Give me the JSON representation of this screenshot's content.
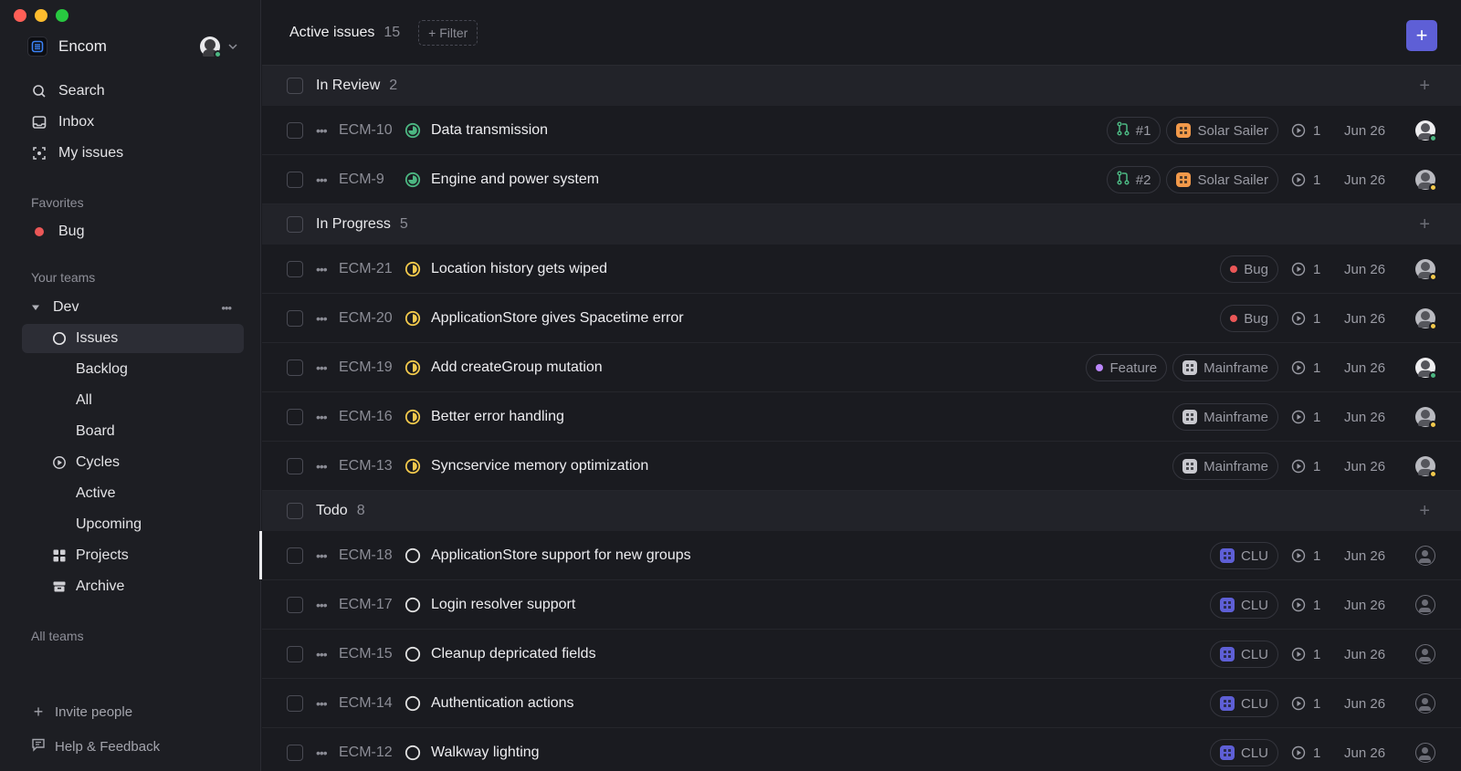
{
  "workspace": {
    "name": "Encom",
    "logo_color": "#3b82f6"
  },
  "sidebar": {
    "nav": [
      {
        "label": "Search",
        "icon": "search-icon"
      },
      {
        "label": "Inbox",
        "icon": "inbox-icon"
      },
      {
        "label": "My issues",
        "icon": "my-issues-icon"
      }
    ],
    "favorites_label": "Favorites",
    "favorites": [
      {
        "label": "Bug",
        "color": "#eb5757"
      }
    ],
    "teams_label": "Your teams",
    "team": {
      "name": "Dev"
    },
    "team_items": [
      {
        "label": "Issues",
        "icon": "issues-icon",
        "active": true
      },
      {
        "label": "Backlog"
      },
      {
        "label": "All"
      },
      {
        "label": "Board"
      },
      {
        "label": "Cycles",
        "icon": "cycles-icon"
      },
      {
        "label": "Active"
      },
      {
        "label": "Upcoming"
      },
      {
        "label": "Projects",
        "icon": "projects-icon"
      },
      {
        "label": "Archive",
        "icon": "archive-icon"
      }
    ],
    "all_teams_label": "All teams",
    "invite_label": "Invite people",
    "help_label": "Help & Feedback"
  },
  "header": {
    "title": "Active issues",
    "count": "15",
    "filter_label": "+ Filter",
    "new_label": "+"
  },
  "colors": {
    "accent": "#5e5fd6",
    "in_review": "#4cb782",
    "in_progress": "#f2c94c",
    "todo": "#e2e2e2"
  },
  "groups": [
    {
      "name": "In Review",
      "count": "2",
      "status": "in_review",
      "rows": [
        {
          "id": "ECM-10",
          "title": "Data transmission",
          "pr": "#1",
          "project": "Solar Sailer",
          "project_color": "#f2994a",
          "cycle": "1",
          "date": "Jun 26",
          "avatar": "light",
          "avatar_status": "#4cb782"
        },
        {
          "id": "ECM-9",
          "title": "Engine and power system",
          "pr": "#2",
          "project": "Solar Sailer",
          "project_color": "#f2994a",
          "cycle": "1",
          "date": "Jun 26",
          "avatar": "gray",
          "avatar_status": "#f2c94c"
        }
      ]
    },
    {
      "name": "In Progress",
      "count": "5",
      "status": "in_progress",
      "rows": [
        {
          "id": "ECM-21",
          "title": "Location history gets wiped",
          "label": "Bug",
          "label_color": "#eb5757",
          "cycle": "1",
          "date": "Jun 26",
          "avatar": "gray",
          "avatar_status": "#f2c94c"
        },
        {
          "id": "ECM-20",
          "title": "ApplicationStore gives Spacetime error",
          "label": "Bug",
          "label_color": "#eb5757",
          "cycle": "1",
          "date": "Jun 26",
          "avatar": "gray",
          "avatar_status": "#f2c94c"
        },
        {
          "id": "ECM-19",
          "title": "Add createGroup mutation",
          "label": "Feature",
          "label_color": "#bb87fc",
          "project": "Mainframe",
          "project_color": "#c9c9cf",
          "cycle": "1",
          "date": "Jun 26",
          "avatar": "light",
          "avatar_status": "#4cb782"
        },
        {
          "id": "ECM-16",
          "title": "Better error handling",
          "project": "Mainframe",
          "project_color": "#c9c9cf",
          "cycle": "1",
          "date": "Jun 26",
          "avatar": "gray",
          "avatar_status": "#f2c94c"
        },
        {
          "id": "ECM-13",
          "title": "Syncservice memory optimization",
          "project": "Mainframe",
          "project_color": "#c9c9cf",
          "cycle": "1",
          "date": "Jun 26",
          "avatar": "gray",
          "avatar_status": "#f2c94c"
        }
      ]
    },
    {
      "name": "Todo",
      "count": "8",
      "status": "todo",
      "rows": [
        {
          "id": "ECM-18",
          "title": "ApplicationStore support for new groups",
          "project": "CLU",
          "project_color": "#5e5fd6",
          "cycle": "1",
          "date": "Jun 26",
          "avatar": "none",
          "selected": true
        },
        {
          "id": "ECM-17",
          "title": "Login resolver support",
          "project": "CLU",
          "project_color": "#5e5fd6",
          "cycle": "1",
          "date": "Jun 26",
          "avatar": "none"
        },
        {
          "id": "ECM-15",
          "title": "Cleanup depricated fields",
          "project": "CLU",
          "project_color": "#5e5fd6",
          "cycle": "1",
          "date": "Jun 26",
          "avatar": "none"
        },
        {
          "id": "ECM-14",
          "title": "Authentication actions",
          "project": "CLU",
          "project_color": "#5e5fd6",
          "cycle": "1",
          "date": "Jun 26",
          "avatar": "none"
        },
        {
          "id": "ECM-12",
          "title": "Walkway lighting",
          "project": "CLU",
          "project_color": "#5e5fd6",
          "cycle": "1",
          "date": "Jun 26",
          "avatar": "none"
        }
      ]
    }
  ]
}
